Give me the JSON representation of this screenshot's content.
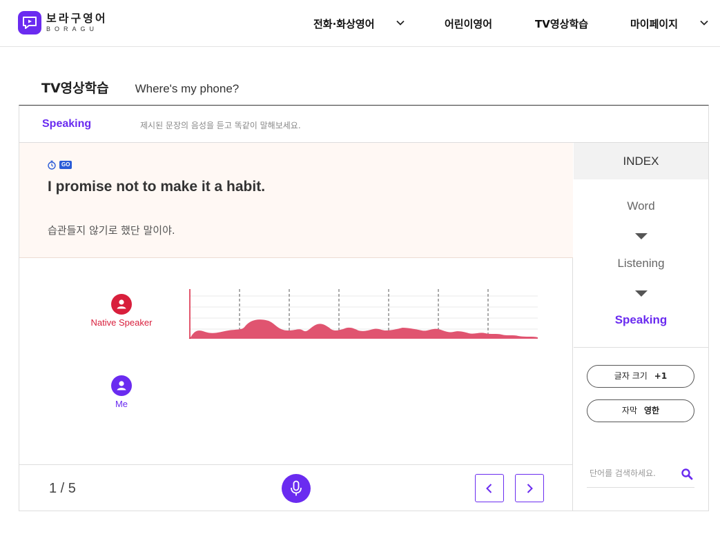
{
  "brand": {
    "name_ko": "보라구영어",
    "name_en": "BORAGU",
    "color": "#6a2bf0"
  },
  "nav": [
    {
      "label": "전화·화상영어",
      "has_dropdown": true
    },
    {
      "label": "어린이영어",
      "has_dropdown": false
    },
    {
      "label": "TV영상학습",
      "has_dropdown": false
    },
    {
      "label": "마이페이지",
      "has_dropdown": true
    }
  ],
  "page": {
    "title": "TV영상학습",
    "episode": "Where's my phone?"
  },
  "stage": {
    "name": "Speaking",
    "instruction": "제시된 문장의 음성을 듣고 똑같이 말해보세요."
  },
  "sentence": {
    "badge": "GO",
    "english": "I promise not to make it a habit.",
    "korean": "습관들지 않기로 했단 말이야."
  },
  "speakers": {
    "native": {
      "label": "Native Speaker",
      "color": "#d81f3c"
    },
    "me": {
      "label": "Me",
      "color": "#6a2bf0"
    }
  },
  "waveform": {
    "color": "#e05470"
  },
  "pager": {
    "current": 1,
    "total": 5,
    "text": "1 / 5"
  },
  "index": {
    "heading": "INDEX",
    "items": [
      {
        "label": "Word",
        "active": false
      },
      {
        "label": "Listening",
        "active": false
      },
      {
        "label": "Speaking",
        "active": true
      }
    ]
  },
  "controls": {
    "font_size": {
      "label": "글자 크기",
      "value": "+1"
    },
    "subtitle": {
      "label": "자막",
      "value": "영한"
    }
  },
  "search": {
    "placeholder": "단어를 검색하세요."
  }
}
